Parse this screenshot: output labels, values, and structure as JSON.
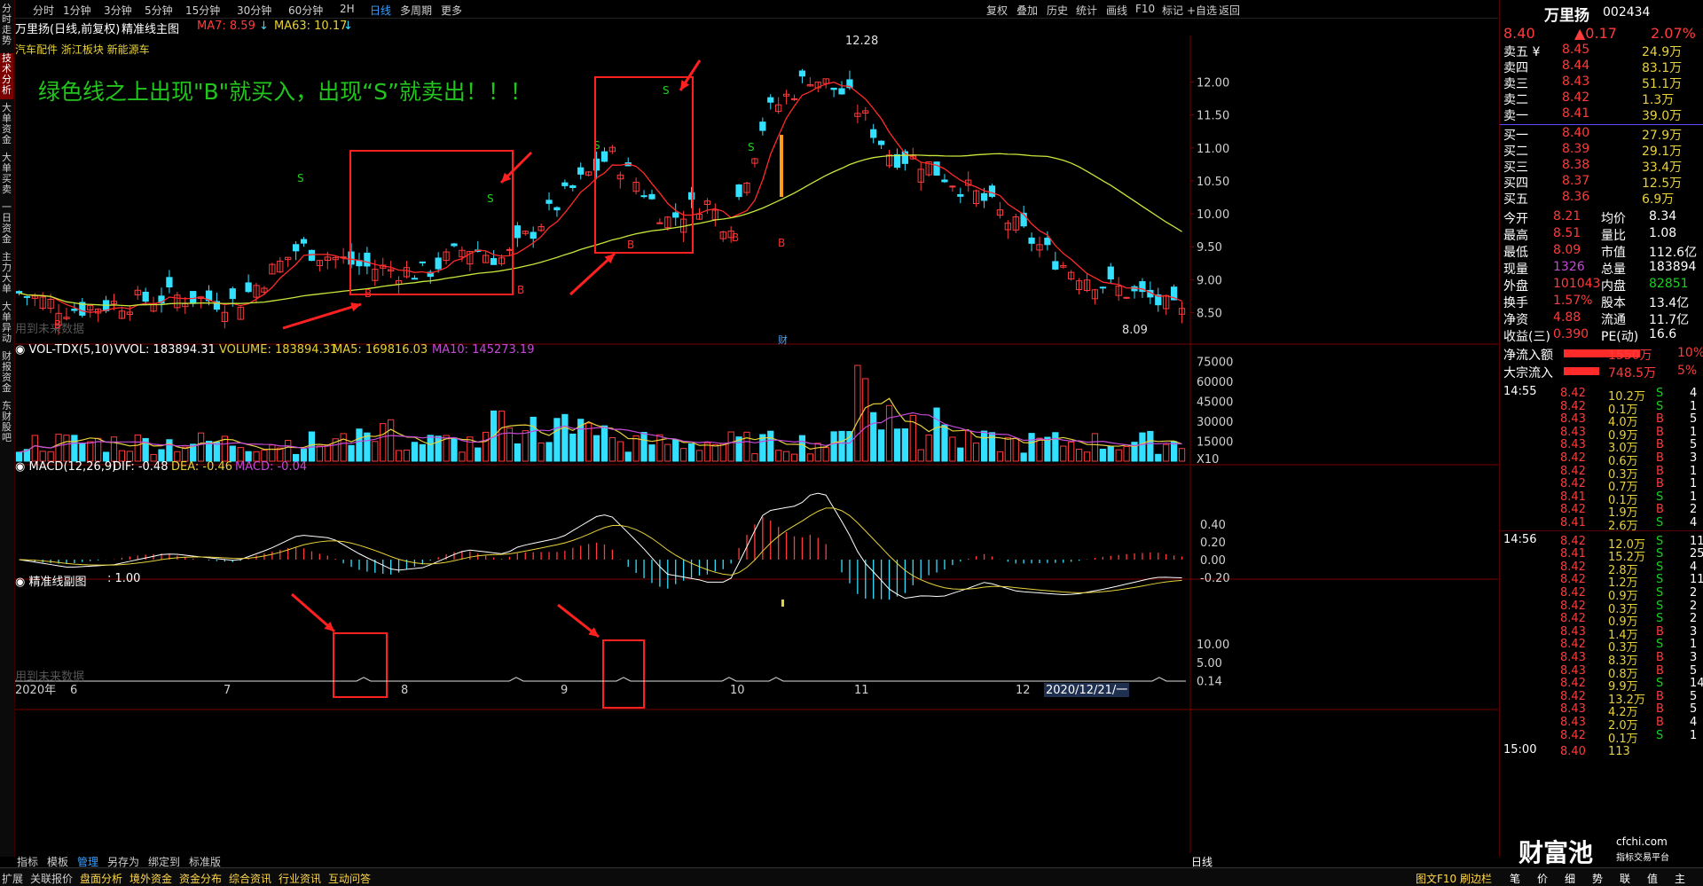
{
  "left_tabs": [
    "分时走势",
    "技术分析",
    "大单资金",
    "大单买卖",
    "一日资金",
    "主力大单",
    "大单异动",
    "财报资金",
    "东财股吧"
  ],
  "top_bar": {
    "periods": [
      "分时",
      "1分钟",
      "3分钟",
      "5分钟",
      "15分钟",
      "30分钟",
      "60分钟",
      "2H",
      "日线",
      "多周期",
      "更多"
    ],
    "active_period": "日线",
    "tools": [
      "复权",
      "叠加",
      "历史",
      "统计",
      "画线",
      "F10",
      "标记",
      "+自选",
      "返回"
    ]
  },
  "chart_header": {
    "stock_name": "万里扬(日线,前复权)",
    "indicator": "精准线主图",
    "ma7": "MA7: 8.59",
    "ma63": "MA63: 10.17",
    "tags": "汽车配件 浙江板块 新能源车"
  },
  "annotation_text": "绿色线之上出现\"B\"就买入，出现“S”就卖出！！！",
  "watermark": "用到未来数据",
  "price_axis": [
    "12.00",
    "11.50",
    "11.00",
    "10.50",
    "10.00",
    "9.50",
    "9.00",
    "8.50"
  ],
  "price_high_label": "12.28",
  "price_low_label": "8.09",
  "vol_header": {
    "name": "VOL-TDX(5,10)",
    "vvol": "VVOL: 183894.31",
    "volume": "VOLUME: 183894.31",
    "ma5": "MA5: 169816.03",
    "ma10": "MA10: 145273.19"
  },
  "vol_axis": [
    "75000",
    "60000",
    "45000",
    "30000",
    "15000",
    "X10"
  ],
  "macd_header": {
    "name": "MACD(12,26,9)",
    "dif": "DIF: -0.48",
    "dea": "DEA: -0.46",
    "macd": "MACD: -0.04"
  },
  "macd_axis": [
    "0.40",
    "0.20",
    "0.00",
    "-0.20"
  ],
  "sub_header": {
    "name": "精准线副图",
    "value": ": 1.00"
  },
  "sub_axis": [
    "10.00",
    "5.00",
    "0.14"
  ],
  "date_axis": [
    "2020年",
    "6",
    "7",
    "8",
    "9",
    "10",
    "11",
    "12"
  ],
  "date_highlight": "2020/12/21/一",
  "cai_marker": "财",
  "quote": {
    "name": "万里扬",
    "code": "002434",
    "price": "8.40",
    "change": "▲0.17",
    "pct": "2.07%",
    "sells": [
      {
        "label": "卖五 ¥",
        "price": "8.45",
        "vol": "24.9万"
      },
      {
        "label": "卖四",
        "price": "8.44",
        "vol": "83.1万"
      },
      {
        "label": "卖三",
        "price": "8.43",
        "vol": "51.1万"
      },
      {
        "label": "卖二",
        "price": "8.42",
        "vol": "1.3万"
      },
      {
        "label": "卖一",
        "price": "8.41",
        "vol": "39.0万"
      }
    ],
    "buys": [
      {
        "label": "买一",
        "price": "8.40",
        "vol": "27.9万"
      },
      {
        "label": "买二",
        "price": "8.39",
        "vol": "29.1万"
      },
      {
        "label": "买三",
        "price": "8.38",
        "vol": "33.4万"
      },
      {
        "label": "买四",
        "price": "8.37",
        "vol": "12.5万"
      },
      {
        "label": "买五",
        "price": "8.36",
        "vol": "6.9万"
      }
    ],
    "stats": [
      [
        "今开",
        "8.21",
        "均价",
        "8.34"
      ],
      [
        "最高",
        "8.51",
        "量比",
        "1.08"
      ],
      [
        "最低",
        "8.09",
        "市值",
        "112.6亿"
      ],
      [
        "现量",
        "1326",
        "总量",
        "183894"
      ],
      [
        "外盘",
        "101043",
        "内盘",
        "82851"
      ],
      [
        "换手",
        "1.57%",
        "股本",
        "13.4亿"
      ],
      [
        "净资",
        "4.88",
        "流通",
        "11.7亿"
      ],
      [
        "收益(三)",
        "0.390",
        "PE(动)",
        "16.6"
      ]
    ],
    "flows": [
      {
        "label": "净流入额",
        "value": "1550万",
        "pct": "10%"
      },
      {
        "label": "大宗流入",
        "value": "748.5万",
        "pct": "5%"
      }
    ],
    "ticks1_time": "14:55",
    "ticks1": [
      [
        "8.42",
        "10.2万",
        "S",
        "4"
      ],
      [
        "8.42",
        "0.1万",
        "S",
        "1"
      ],
      [
        "8.43",
        "4.0万",
        "B",
        "5"
      ],
      [
        "8.43",
        "0.9万",
        "B",
        "1"
      ],
      [
        "8.43",
        "3.0万",
        "B",
        "5"
      ],
      [
        "8.42",
        "0.6万",
        "B",
        "3"
      ],
      [
        "8.42",
        "0.3万",
        "B",
        "1"
      ],
      [
        "8.42",
        "0.7万",
        "B",
        "1"
      ],
      [
        "8.41",
        "0.1万",
        "S",
        "1"
      ],
      [
        "8.42",
        "1.9万",
        "B",
        "2"
      ],
      [
        "8.41",
        "2.6万",
        "S",
        "4"
      ]
    ],
    "ticks2_time": "14:56",
    "ticks2": [
      [
        "8.42",
        "12.0万",
        "S",
        "11"
      ],
      [
        "8.41",
        "15.2万",
        "S",
        "25"
      ],
      [
        "8.42",
        "2.8万",
        "S",
        "4"
      ],
      [
        "8.42",
        "1.2万",
        "S",
        "11"
      ],
      [
        "8.42",
        "0.9万",
        "S",
        "2"
      ],
      [
        "8.42",
        "0.3万",
        "S",
        "2"
      ],
      [
        "8.42",
        "0.9万",
        "S",
        "2"
      ],
      [
        "8.43",
        "1.4万",
        "B",
        "3"
      ],
      [
        "8.42",
        "0.3万",
        "S",
        "1"
      ],
      [
        "8.43",
        "8.3万",
        "B",
        "3"
      ],
      [
        "8.43",
        "0.8万",
        "B",
        "5"
      ],
      [
        "8.42",
        "9.9万",
        "S",
        "14"
      ],
      [
        "8.42",
        "13.2万",
        "B",
        "5"
      ],
      [
        "8.43",
        "4.2万",
        "B",
        "5"
      ],
      [
        "8.43",
        "2.0万",
        "B",
        "4"
      ],
      [
        "8.42",
        "0.1万",
        "S",
        "1"
      ]
    ],
    "ticks3_time": "15:00",
    "ticks3": [
      [
        "8.40",
        "113"
      ]
    ]
  },
  "bottom_bar": {
    "left": [
      "扩展",
      "关联报价",
      "盘面分析",
      "境外资金",
      "资金分布",
      "综合资讯",
      "行业资讯",
      "互动问答"
    ],
    "sub_left": [
      "指标",
      "模板",
      "管理",
      "另存为",
      "绑定到",
      "标准版"
    ],
    "right": "图文F10 刷边栏",
    "mini": [
      "笔",
      "价",
      "细",
      "势",
      "联",
      "值",
      "主"
    ],
    "day_label": "日线",
    "brand": "财富池",
    "brand_site": "cfchi.com",
    "brand_sub": "指标交易平台"
  },
  "colors": {
    "up": "#ff3b3b",
    "down": "#33e0ff",
    "ma_short": "#ff2a2a",
    "ma_long": "#c8e83c",
    "annotation": "#22c51e",
    "box": "#ff2020"
  }
}
